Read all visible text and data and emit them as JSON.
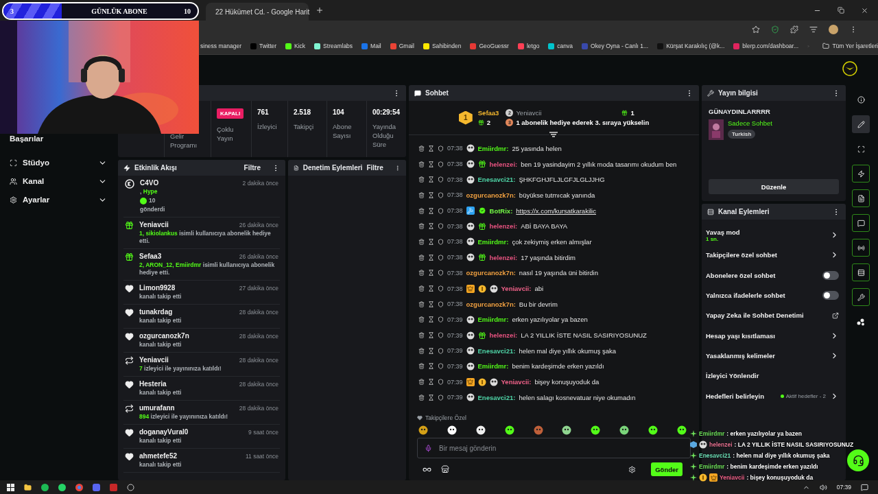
{
  "subscriber_goal": {
    "current": "3",
    "label": "GÜNLÜK ABONE",
    "target": "10",
    "level": 0.3
  },
  "browser": {
    "tab": {
      "title": "22 Hükümet Cd. - Google Harit"
    },
    "bookmarks": [
      {
        "label": "siness manager"
      },
      {
        "label": "Twitter"
      },
      {
        "label": "Kick"
      },
      {
        "label": "Streamlabs"
      },
      {
        "label": "Mail"
      },
      {
        "label": "Gmail"
      },
      {
        "label": "Sahibinden"
      },
      {
        "label": "GeoGuessr"
      },
      {
        "label": "letgo"
      },
      {
        "label": "canva"
      },
      {
        "label": "Okey Oyna - Canlı 1..."
      },
      {
        "label": "Kürşat Karakılıç (@k..."
      },
      {
        "label": "blerp.com/dashboar..."
      }
    ],
    "all_bookmarks": "Tüm Yer İşaretleri"
  },
  "sidebar": {
    "items": [
      {
        "kind": "link",
        "label": "Başarılar"
      },
      {
        "kind": "menu",
        "label": "Stüdyo",
        "expanded": false
      },
      {
        "kind": "menu",
        "label": "Kanal",
        "expanded": false
      },
      {
        "kind": "menu",
        "label": "Ayarlar",
        "expanded": false
      }
    ]
  },
  "stats": {
    "cells": [
      {
        "kind": "hidden"
      },
      {
        "kind": "label",
        "label": "Gelir Programı"
      },
      {
        "kind": "badge",
        "badge": "KAPALI",
        "label": "Çoklu Yayın"
      },
      {
        "kind": "value",
        "value": "761",
        "label": "İzleyici"
      },
      {
        "kind": "value",
        "value": "2.518",
        "label": "Takipçi"
      },
      {
        "kind": "value",
        "value": "104",
        "label": "Abone Sayısı"
      },
      {
        "kind": "value",
        "value": "00:29:54",
        "label": "Yayında Olduğu Süre"
      }
    ]
  },
  "activity_feed": {
    "title": "Etkinlik Akışı",
    "filter": "Filtre",
    "events": [
      {
        "kind": "kicks",
        "user": "C4VO",
        "time": "2 dakika önce",
        "prefix": ",",
        "highlight": "Hype",
        "amount": "10",
        "text": "gönderdi"
      },
      {
        "kind": "gift",
        "user": "Yeniavcii",
        "time": "26 dakika önce",
        "highlight": "1, sikiolankus",
        "text": "isimli kullanıcıya abonelik hediye etti."
      },
      {
        "kind": "gift",
        "user": "Sefaa3",
        "time": "26 dakika önce",
        "highlight": "2, ARON_12, Emiirdmr",
        "text": "isimli kullanıcıya abonelik hediye etti."
      },
      {
        "kind": "follow",
        "user": "Limon9928",
        "time": "27 dakika önce",
        "text": "kanalı takip etti"
      },
      {
        "kind": "follow",
        "user": "tunakrdag",
        "time": "28 dakika önce",
        "text": "kanalı takip etti"
      },
      {
        "kind": "follow",
        "user": "ozgurcanozk7n",
        "time": "28 dakika önce",
        "text": "kanalı takip etti"
      },
      {
        "kind": "host",
        "user": "Yeniavcii",
        "time": "28 dakika önce",
        "highlight": "7",
        "text": "izleyici ile yayınınıza katıldı!"
      },
      {
        "kind": "follow",
        "user": "Hesteria",
        "time": "28 dakika önce",
        "text": "kanalı takip etti"
      },
      {
        "kind": "host",
        "user": "umurafann",
        "time": "28 dakika önce",
        "highlight": "894",
        "text": "izleyici ile yayınınıza katıldı!"
      },
      {
        "kind": "follow",
        "user": "doganayVural0",
        "time": "9 saat önce",
        "text": "kanalı takip etti"
      },
      {
        "kind": "follow",
        "user": "ahmetefe52",
        "time": "11 saat önce",
        "text": "kanalı takip etti"
      }
    ]
  },
  "moderation": {
    "title": "Denetim Eylemleri",
    "filter": "Filtre"
  },
  "chat": {
    "title": "Sohbet",
    "leaderboard": {
      "first": {
        "rank": "1",
        "user": "Sefaa3",
        "count": "2"
      },
      "second": {
        "rank": "2",
        "user": "Yeniavcii",
        "count": "1"
      },
      "third": {
        "rank": "3",
        "text": "1 abonelik hediye ederek 3. sıraya yükselin"
      }
    },
    "messages": [
      {
        "time": "07:38",
        "badges": [
          {
            "kind": "emote"
          }
        ],
        "user": "Emiirdmr:",
        "color": "#53fc18",
        "text": "25 yasında helen"
      },
      {
        "time": "07:38",
        "badges": [
          {
            "kind": "emote"
          },
          {
            "kind": "gift"
          }
        ],
        "user": "helenzei:",
        "color": "#e5527f",
        "text": "ben 19 yasindayim 2 yıllık moda tasarımı okudum ben"
      },
      {
        "time": "07:38",
        "badges": [
          {
            "kind": "emote"
          }
        ],
        "user": "Enesavci21:",
        "color": "#4fd6a8",
        "text": "ŞHKFGHJFLJLGFJLGLJJHG"
      },
      {
        "time": "07:38",
        "user": "ozgurcanozk7n:",
        "color": "#f0a040",
        "text": "büyükse tutmıcak yanında"
      },
      {
        "time": "07:38",
        "badges": [
          {
            "kind": "hammer"
          },
          {
            "kind": "verified"
          }
        ],
        "user": "BotRix:",
        "color": "#75fd46",
        "text": "https://x.com/kursatkarakilic",
        "link": true
      },
      {
        "time": "07:38",
        "badges": [
          {
            "kind": "emote"
          },
          {
            "kind": "gift"
          }
        ],
        "user": "helenzei:",
        "color": "#e5527f",
        "text": "ABİ BAYA BAYA"
      },
      {
        "time": "07:38",
        "badges": [
          {
            "kind": "emote"
          }
        ],
        "user": "Emiirdmr:",
        "color": "#53fc18",
        "text": "çok zekiymiş erken almışlar"
      },
      {
        "time": "07:38",
        "badges": [
          {
            "kind": "emote"
          },
          {
            "kind": "gift"
          }
        ],
        "user": "helenzei:",
        "color": "#e5527f",
        "text": "17 yaşında bitirdim"
      },
      {
        "time": "07:38",
        "user": "ozgurcanozk7n:",
        "color": "#f0a040",
        "text": "nasıl 19 yaşında üni bitirdin"
      },
      {
        "time": "07:38",
        "badges": [
          {
            "kind": "crown"
          },
          {
            "kind": "rank"
          },
          {
            "kind": "emote"
          }
        ],
        "user": "Yeniavcii:",
        "color": "#f2628a",
        "text": "abi"
      },
      {
        "time": "07:38",
        "user": "ozgurcanozk7n:",
        "color": "#f0a040",
        "text": "Bu bir devrim"
      },
      {
        "time": "07:39",
        "badges": [
          {
            "kind": "emote"
          }
        ],
        "user": "Emiirdmr:",
        "color": "#53fc18",
        "text": "erken yazılıyolar ya bazen"
      },
      {
        "time": "07:39",
        "badges": [
          {
            "kind": "emote"
          },
          {
            "kind": "gift"
          }
        ],
        "user": "helenzei:",
        "color": "#e5527f",
        "text": "LA 2 YILLIK İSTE NASIL SASIRIYOSUNUZ"
      },
      {
        "time": "07:39",
        "badges": [
          {
            "kind": "emote"
          }
        ],
        "user": "Enesavci21:",
        "color": "#4fd6a8",
        "text": "helen mal diye yıllık okumuş şaka"
      },
      {
        "time": "07:39",
        "badges": [
          {
            "kind": "emote"
          }
        ],
        "user": "Emiirdmr:",
        "color": "#53fc18",
        "text": "benim kardeşimde erken yazıldı"
      },
      {
        "time": "07:39",
        "badges": [
          {
            "kind": "crown"
          },
          {
            "kind": "rank"
          },
          {
            "kind": "emote"
          }
        ],
        "user": "Yeniavcii:",
        "color": "#f2628a",
        "text": "bişey konuşuyoduk da"
      },
      {
        "time": "07:39",
        "badges": [
          {
            "kind": "emote"
          }
        ],
        "user": "Enesavci21:",
        "color": "#4fd6a8",
        "text": "helen salagı kosnevatuar niye okumadın"
      }
    ],
    "emote_section": "Takipçilere Özel",
    "input": {
      "placeholder": "Bir mesaj gönderin"
    },
    "send": "Gönder"
  },
  "stream_info": {
    "title": "Yayın bilgisi",
    "stream_title": "GÜNAYDINLARRRR",
    "category": "Sadece Sohbet",
    "tag": "Turkish",
    "edit": "Düzenle"
  },
  "channel_actions": {
    "title": "Kanal Eylemleri",
    "items": [
      {
        "kind": "submenu",
        "label": "Yavaş mod",
        "value": "1 sn."
      },
      {
        "kind": "submenu",
        "label": "Takipçilere özel sohbet"
      },
      {
        "kind": "toggle",
        "label": "Abonelere özel sohbet",
        "on": false
      },
      {
        "kind": "toggle",
        "label": "Yalnızca ifadelerle sohbet",
        "on": false
      },
      {
        "kind": "external",
        "label": "Yapay Zeka ile Sohbet Denetimi"
      },
      {
        "kind": "submenu",
        "label": "Hesap yaşı kısıtlaması"
      },
      {
        "kind": "submenu",
        "label": "Yasaklanmış kelimeler"
      },
      {
        "kind": "plain",
        "label": "İzleyici Yönlendir"
      },
      {
        "kind": "submenu",
        "label": "Hedefleri belirleyin",
        "status": "Aktif hedefler - 2"
      }
    ]
  },
  "rail": [
    {
      "selected": false,
      "on": false
    },
    {
      "selected": true,
      "on": false
    },
    {
      "selected": false,
      "on": false
    },
    {
      "selected": false,
      "on": true
    },
    {
      "selected": false,
      "on": true
    },
    {
      "selected": false,
      "on": true
    },
    {
      "selected": false,
      "on": true
    },
    {
      "selected": false,
      "on": true
    },
    {
      "selected": false,
      "on": true
    },
    {
      "selected": false,
      "on": false
    }
  ],
  "chat_overlay": [
    {
      "badges": [
        {
          "kind": "sparkle"
        }
      ],
      "user": "Emiirdmr",
      "color": "#6ee05a",
      "text": ": erken yazılıyolar ya bazen"
    },
    {
      "badges": [
        {
          "kind": "cube"
        },
        {
          "kind": "emote"
        }
      ],
      "user": "helenzei",
      "color": "#e5708f",
      "text": ": LA 2 YILLIK İSTE NASIL SASIRIYOSUNUZ"
    },
    {
      "badges": [
        {
          "kind": "sparkle"
        }
      ],
      "user": "Enesavci21",
      "color": "#6ee0b8",
      "text": ": helen mal diye yıllık okumuş şaka"
    },
    {
      "badges": [
        {
          "kind": "sparkle"
        }
      ],
      "user": "Emiirdmr",
      "color": "#6ee05a",
      "text": ": benim kardeşimde erken yazıldı"
    },
    {
      "badges": [
        {
          "kind": "sparkle"
        },
        {
          "kind": "rank"
        },
        {
          "kind": "crown"
        }
      ],
      "user": "Yeniavcii",
      "color": "#f2628a",
      "text": ": bişey konuşuyoduk da"
    }
  ],
  "taskbar": {
    "time": "07:39"
  }
}
